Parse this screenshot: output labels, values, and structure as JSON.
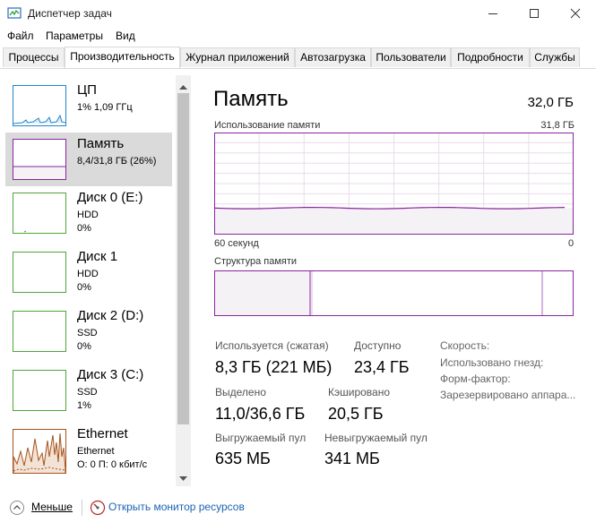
{
  "window": {
    "title": "Диспетчер задач"
  },
  "menu": [
    "Файл",
    "Параметры",
    "Вид"
  ],
  "tabs": [
    {
      "label": "Процессы",
      "active": false
    },
    {
      "label": "Производительность",
      "active": true
    },
    {
      "label": "Журнал приложений",
      "active": false
    },
    {
      "label": "Автозагрузка",
      "active": false
    },
    {
      "label": "Пользователи",
      "active": false
    },
    {
      "label": "Подробности",
      "active": false
    },
    {
      "label": "Службы",
      "active": false
    }
  ],
  "sidebar": {
    "items": [
      {
        "title": "ЦП",
        "line1": "1% 1,09 ГГц",
        "line2": "",
        "color": "#1e86c8"
      },
      {
        "title": "Память",
        "line1": "8,4/31,8 ГБ (26%)",
        "line2": "",
        "color": "#8b23a1"
      },
      {
        "title": "Диск 0 (E:)",
        "line1": "HDD",
        "line2": "0%",
        "color": "#4da638"
      },
      {
        "title": "Диск 1",
        "line1": "HDD",
        "line2": "0%",
        "color": "#4da638"
      },
      {
        "title": "Диск 2 (D:)",
        "line1": "SSD",
        "line2": "0%",
        "color": "#4da638"
      },
      {
        "title": "Диск 3 (C:)",
        "line1": "SSD",
        "line2": "1%",
        "color": "#4da638"
      },
      {
        "title": "Ethernet",
        "line1": "Ethernet",
        "line2": "О: 0 П: 0 кбит/с",
        "color": "#a7521b"
      }
    ]
  },
  "main": {
    "title": "Память",
    "total": "32,0 ГБ",
    "usage_label": "Использование памяти",
    "usage_max": "31,8 ГБ",
    "axis_left": "60 секунд",
    "axis_right": "0",
    "usage_percent": 26,
    "structure_label": "Структура памяти",
    "stats": {
      "in_use_label": "Используется (сжатая)",
      "in_use_value": "8,3 ГБ (221 МБ)",
      "available_label": "Доступно",
      "available_value": "23,4 ГБ",
      "committed_label": "Выделено",
      "committed_value": "11,0/36,6 ГБ",
      "cached_label": "Кэшировано",
      "cached_value": "20,5 ГБ",
      "paged_label": "Выгружаемый пул",
      "paged_value": "635 МБ",
      "nonpaged_label": "Невыгружаемый пул",
      "nonpaged_value": "341 МБ",
      "speed_label": "Скорость:",
      "slots_label": "Использовано гнезд:",
      "form_label": "Форм-фактор:",
      "reserved_label": "Зарезервировано аппара..."
    }
  },
  "bottom": {
    "less_label": "Меньше",
    "monitor_label": "Открыть монитор ресурсов"
  },
  "colors": {
    "memory": "#8b23a1",
    "memory_fill": "#f4f2f4",
    "link": "#1a64b5"
  }
}
